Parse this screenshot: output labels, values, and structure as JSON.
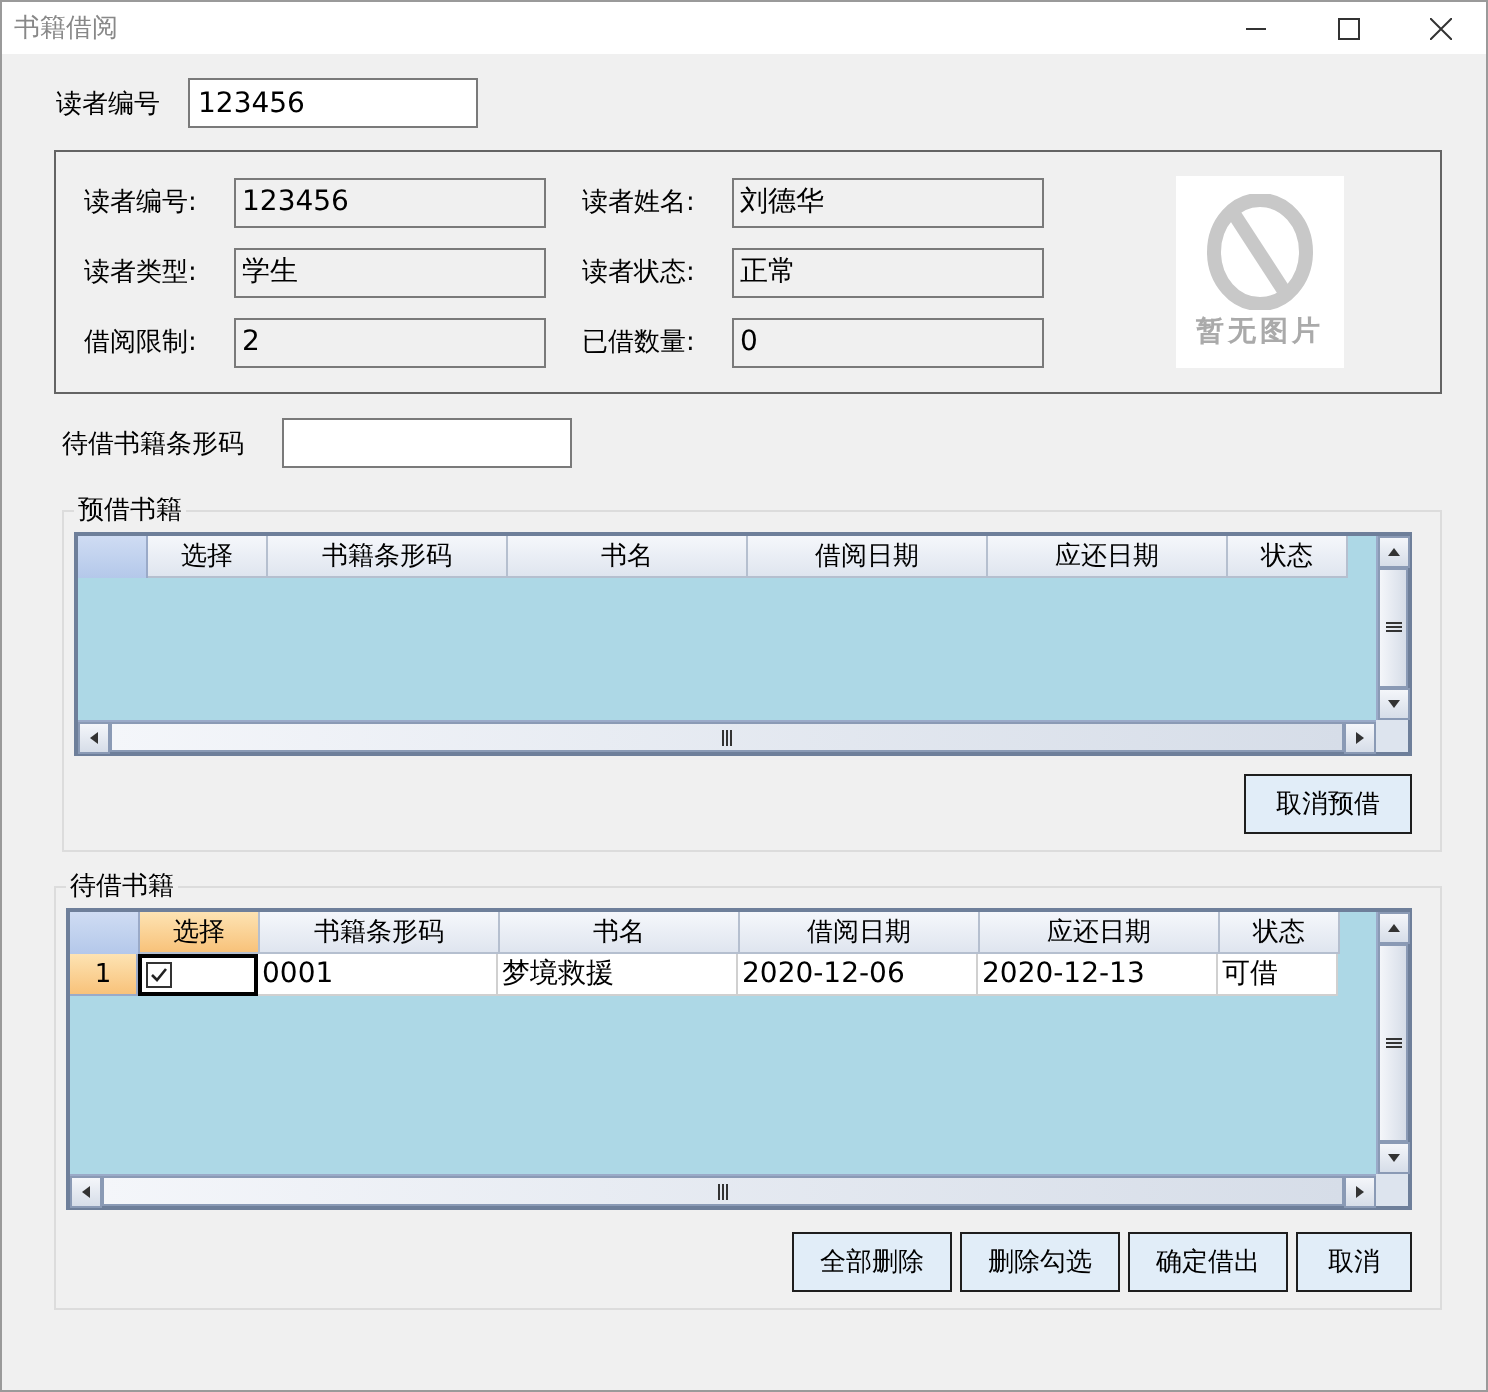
{
  "window": {
    "title": "书籍借阅"
  },
  "reader_lookup": {
    "label": "读者编号",
    "value": "123456"
  },
  "reader_info": {
    "fields": [
      {
        "label": "读者编号:",
        "value": "123456"
      },
      {
        "label": "读者姓名:",
        "value": "刘德华"
      },
      {
        "label": "读者类型:",
        "value": "学生"
      },
      {
        "label": "读者状态:",
        "value": "正常"
      },
      {
        "label": "借阅限制:",
        "value": "2"
      },
      {
        "label": "已借数量:",
        "value": "0"
      }
    ],
    "photo_placeholder": {
      "text": "暂无图片"
    }
  },
  "barcode_entry": {
    "label": "待借书籍条形码"
  },
  "reserved_books": {
    "title": "预借书籍",
    "columns": [
      {
        "label": "选择",
        "selected": false
      },
      {
        "label": "书籍条形码",
        "selected": false
      },
      {
        "label": "书名",
        "selected": false
      },
      {
        "label": "借阅日期",
        "selected": false
      },
      {
        "label": "应还日期",
        "selected": false
      },
      {
        "label": "状态",
        "selected": false
      }
    ],
    "buttons": [
      "取消预借"
    ]
  },
  "pending_books": {
    "title": "待借书籍",
    "columns": [
      {
        "label": "选择",
        "selected": true
      },
      {
        "label": "书籍条形码",
        "selected": false
      },
      {
        "label": "书名",
        "selected": false
      },
      {
        "label": "借阅日期",
        "selected": false
      },
      {
        "label": "应还日期",
        "selected": false
      },
      {
        "label": "状态",
        "selected": false
      }
    ],
    "rows": [
      {
        "number": "1",
        "selected": true,
        "checked": true,
        "cells": [
          "",
          "0001",
          "梦境救援",
          "2020-12-06",
          "2020-12-13",
          "可借"
        ]
      }
    ],
    "buttons": [
      "全部删除",
      "删除勾选",
      "确定借出",
      "取消"
    ]
  }
}
